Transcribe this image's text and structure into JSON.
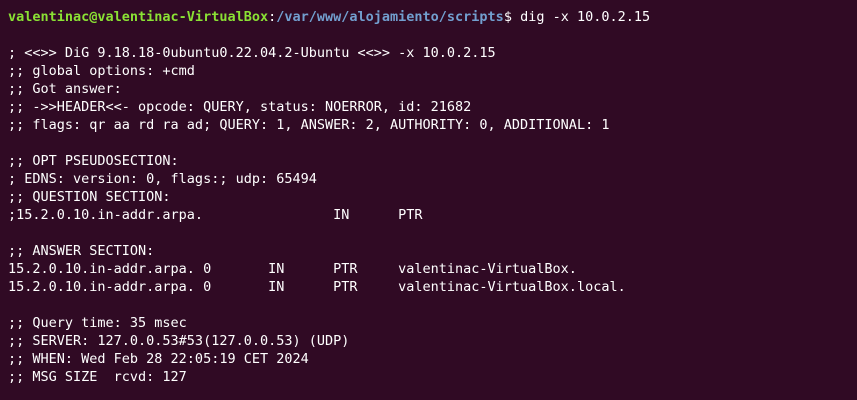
{
  "prompt": {
    "user_host": "valentinac@valentinac-VirtualBox",
    "separator": ":",
    "path": "/var/www/alojamiento/scripts",
    "dollar": "$",
    "command": "dig -x 10.0.2.15"
  },
  "output": {
    "header": [
      "; <<>> DiG 9.18.18-0ubuntu0.22.04.2-Ubuntu <<>> -x 10.0.2.15",
      ";; global options: +cmd",
      ";; Got answer:",
      ";; ->>HEADER<<- opcode: QUERY, status: NOERROR, id: 21682",
      ";; flags: qr aa rd ra ad; QUERY: 1, ANSWER: 2, AUTHORITY: 0, ADDITIONAL: 1"
    ],
    "opt": [
      ";; OPT PSEUDOSECTION:",
      "; EDNS: version: 0, flags:; udp: 65494",
      ";; QUESTION SECTION:",
      ";15.2.0.10.in-addr.arpa.                IN      PTR"
    ],
    "answer": [
      ";; ANSWER SECTION:",
      "15.2.0.10.in-addr.arpa. 0       IN      PTR     valentinac-VirtualBox.",
      "15.2.0.10.in-addr.arpa. 0       IN      PTR     valentinac-VirtualBox.local."
    ],
    "stats": [
      ";; Query time: 35 msec",
      ";; SERVER: 127.0.0.53#53(127.0.0.53) (UDP)",
      ";; WHEN: Wed Feb 28 22:05:19 CET 2024",
      ";; MSG SIZE  rcvd: 127"
    ]
  },
  "colors": {
    "background": "#300a24",
    "prompt_user": "#8ae234",
    "prompt_path": "#729fcf",
    "text": "#ffffff"
  }
}
